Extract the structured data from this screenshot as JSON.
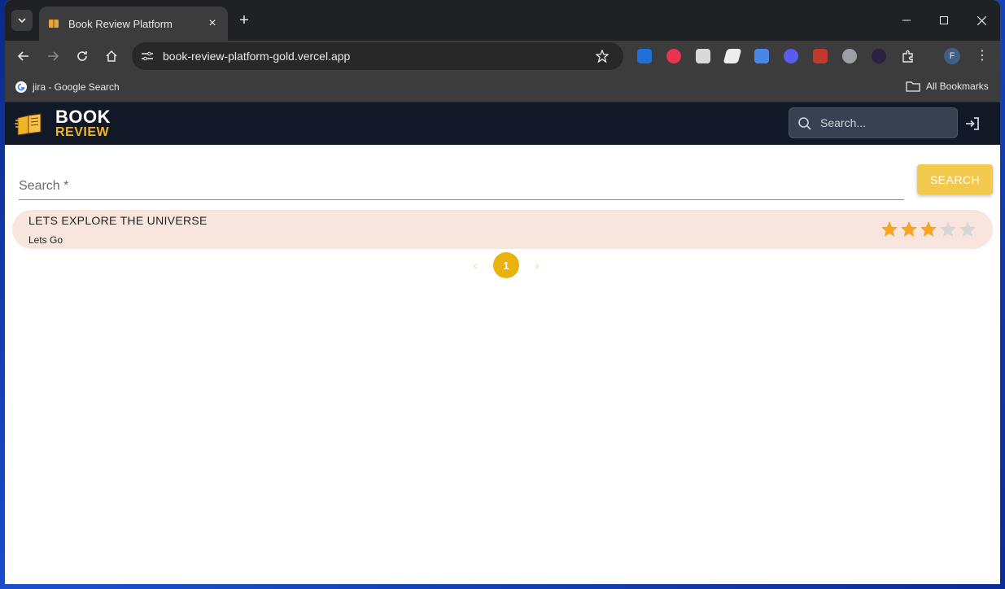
{
  "browser": {
    "tab_title": "Book Review Platform",
    "url": "book-review-platform-gold.vercel.app",
    "bookmarks": [
      {
        "label": "jira - Google Search",
        "icon": "google-icon"
      },
      {
        "label": "All Bookmarks",
        "icon": "folder-icon"
      }
    ],
    "profile_initial": "F"
  },
  "site": {
    "logo_top": "BOOK",
    "logo_bottom": "REVIEW",
    "header_search_placeholder": "Search...",
    "accent_color": "#f0b429",
    "header_bg": "#111827"
  },
  "search": {
    "label": "Search *",
    "button_label": "SEARCH"
  },
  "books": [
    {
      "title": "LETS EXPLORE THE UNIVERSE",
      "subtitle": "Lets Go",
      "rating": 3,
      "max_rating": 5
    }
  ],
  "pagination": {
    "current_page": "1",
    "prev_icon": "chevron-left-icon",
    "next_icon": "chevron-right-icon"
  }
}
